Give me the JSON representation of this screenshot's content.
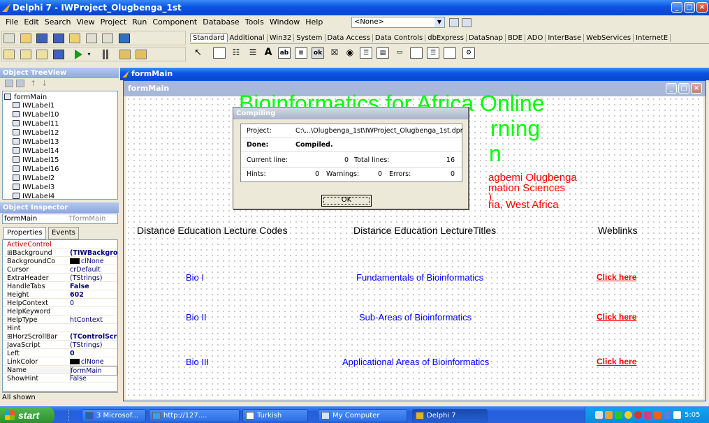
{
  "ide": {
    "title": "Delphi 7 - IWProject_Olugbenga_1st",
    "menu": [
      "File",
      "Edit",
      "Search",
      "View",
      "Project",
      "Run",
      "Component",
      "Database",
      "Tools",
      "Window",
      "Help"
    ],
    "config_combo": "<None>",
    "palette_tabs": [
      "Standard",
      "Additional",
      "Win32",
      "System",
      "Data Access",
      "Data Controls",
      "dbExpress",
      "DataSnap",
      "BDE",
      "ADO",
      "InterBase",
      "WebServices",
      "InternetE"
    ]
  },
  "object_treeview": {
    "title": "Object TreeView",
    "root": "formMain",
    "items": [
      "IWLabel1",
      "IWLabel10",
      "IWLabel11",
      "IWLabel12",
      "IWLabel13",
      "IWLabel14",
      "IWLabel15",
      "IWLabel16",
      "IWLabel2",
      "IWLabel3",
      "IWLabel4"
    ]
  },
  "object_inspector": {
    "title": "Object Inspector",
    "selected_name": "formMain",
    "selected_type": "TformMain",
    "tab_properties": "Properties",
    "tab_events": "Events",
    "properties": [
      {
        "name": "ActiveControl",
        "value": ""
      },
      {
        "name": "⊞Background",
        "value": "(TIWBackgro"
      },
      {
        "name": "BackgroundCo",
        "value": "clNone"
      },
      {
        "name": "Cursor",
        "value": "crDefault"
      },
      {
        "name": "ExtraHeader",
        "value": "(TStrings)"
      },
      {
        "name": "HandleTabs",
        "value": "False"
      },
      {
        "name": "Height",
        "value": "602"
      },
      {
        "name": "HelpContext",
        "value": "0"
      },
      {
        "name": "HelpKeyword",
        "value": ""
      },
      {
        "name": "HelpType",
        "value": "htContext"
      },
      {
        "name": "Hint",
        "value": ""
      },
      {
        "name": "⊞HorzScrollBar",
        "value": "(TControlScro"
      },
      {
        "name": "JavaScript",
        "value": "(TStrings)"
      },
      {
        "name": "Left",
        "value": "0"
      },
      {
        "name": "LinkColor",
        "value": "clNone"
      },
      {
        "name": "Name",
        "value": "formMain"
      },
      {
        "name": "ShowHint",
        "value": "False"
      }
    ],
    "status": "All shown"
  },
  "form": {
    "outer_title": "formMain",
    "caption": "formMain",
    "heading_line1": "Bioinformatics for Africa Online",
    "heading_line2": "rning",
    "heading_line3": "n",
    "author_line1": "agbemi Olugbenga",
    "author_line2": "mation Sciences",
    "author_line3": ")",
    "author_line4": "ria, West Africa",
    "col_codes": "Distance Education Lecture Codes",
    "col_titles": "Distance Education LectureTitles",
    "col_links": "Weblinks",
    "rows": [
      {
        "code": "Bio I",
        "title": "Fundamentals of Bioinformatics",
        "link": "Click here"
      },
      {
        "code": "Bio II",
        "title": "Sub-Areas of Bioinformatics",
        "link": "Click here"
      },
      {
        "code": "Bio III",
        "title": "Applicational Areas of Bioinformatics",
        "link": "Click here"
      }
    ]
  },
  "compile_dialog": {
    "title": "Compiling",
    "project_label": "Project:",
    "project_value": "C:\\...\\Olugbenga_1st\\IWProject_Olugbenga_1st.dpr",
    "done_label": "Done:",
    "done_value": "Compiled.",
    "current_line_label": "Current line:",
    "current_line_value": "0",
    "total_lines_label": "Total lines:",
    "total_lines_value": "16",
    "hints_label": "Hints:",
    "hints_value": "0",
    "warnings_label": "Warnings:",
    "warnings_value": "0",
    "errors_label": "Errors:",
    "errors_value": "0",
    "ok_label": "OK"
  },
  "taskbar": {
    "start": "start",
    "tasks": [
      "3 Microsof...",
      "http://127....",
      "Turkish",
      "My Computer",
      "Delphi 7"
    ],
    "clock": "5:05 PM"
  },
  "colors": {
    "xp_blue": "#0a54e4",
    "form_green": "#00ff00",
    "link_red": "#ff0000",
    "bio_blue": "#0000ff"
  }
}
